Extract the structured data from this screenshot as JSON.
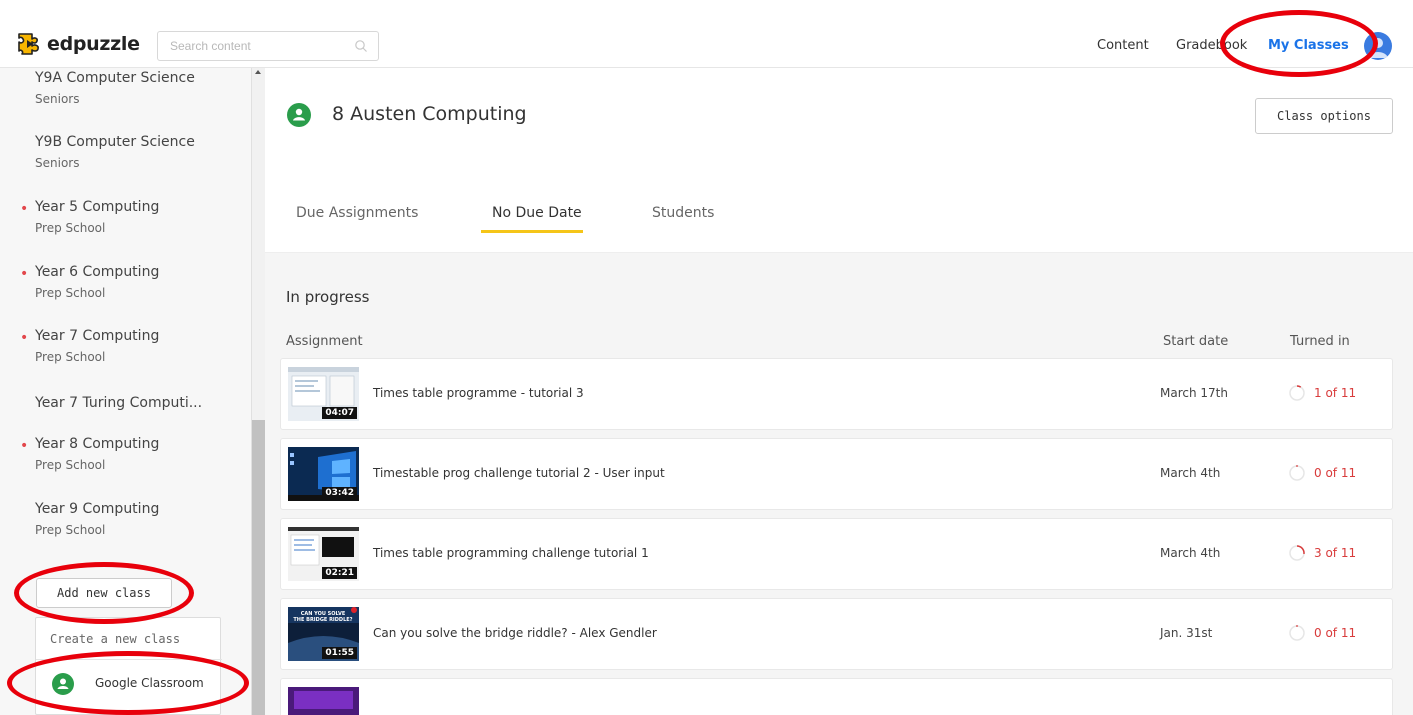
{
  "header": {
    "logo_text": "edpuzzle",
    "search_placeholder": "Search content",
    "nav": [
      "Content",
      "Gradebook",
      "My Classes"
    ],
    "active_nav": "My Classes"
  },
  "sidebar": {
    "classes": [
      {
        "name": "Y9A Computer Science",
        "sub": "Seniors",
        "dot": false
      },
      {
        "name": "Y9B Computer Science",
        "sub": "Seniors",
        "dot": false
      },
      {
        "name": "Year 5 Computing",
        "sub": "Prep School",
        "dot": true
      },
      {
        "name": "Year 6 Computing",
        "sub": "Prep School",
        "dot": true
      },
      {
        "name": "Year 7 Computing",
        "sub": "Prep School",
        "dot": true
      },
      {
        "name": "Year 7 Turing Computi...",
        "sub": "",
        "dot": false
      },
      {
        "name": "Year 8 Computing",
        "sub": "Prep School",
        "dot": true
      },
      {
        "name": "Year 9 Computing",
        "sub": "Prep School",
        "dot": false
      }
    ],
    "add_class_label": "Add new class",
    "dropdown": {
      "create_label": "Create a new class",
      "google_label": "Google Classroom"
    }
  },
  "main": {
    "class_title": "8 Austen Computing",
    "class_options_label": "Class options",
    "tabs": [
      "Due Assignments",
      "No Due Date",
      "Students"
    ],
    "active_tab": "No Due Date",
    "section_title": "In progress",
    "columns": {
      "assignment": "Assignment",
      "start_date": "Start date",
      "turned_in": "Turned in"
    },
    "assignments": [
      {
        "title": "Times table programme - tutorial 3",
        "duration": "04:07",
        "date": "March 17th",
        "turned": "1 of 11",
        "progress": 0.09
      },
      {
        "title": "Timestable prog challenge tutorial 2 - User input",
        "duration": "03:42",
        "date": "March 4th",
        "turned": "0 of 11",
        "progress": 0.0
      },
      {
        "title": "Times table programming challenge tutorial 1",
        "duration": "02:21",
        "date": "March 4th",
        "turned": "3 of 11",
        "progress": 0.27
      },
      {
        "title": "Can you solve the bridge riddle? - Alex Gendler",
        "duration": "01:55",
        "date": "Jan. 31st",
        "turned": "0 of 11",
        "progress": 0.0
      }
    ]
  }
}
